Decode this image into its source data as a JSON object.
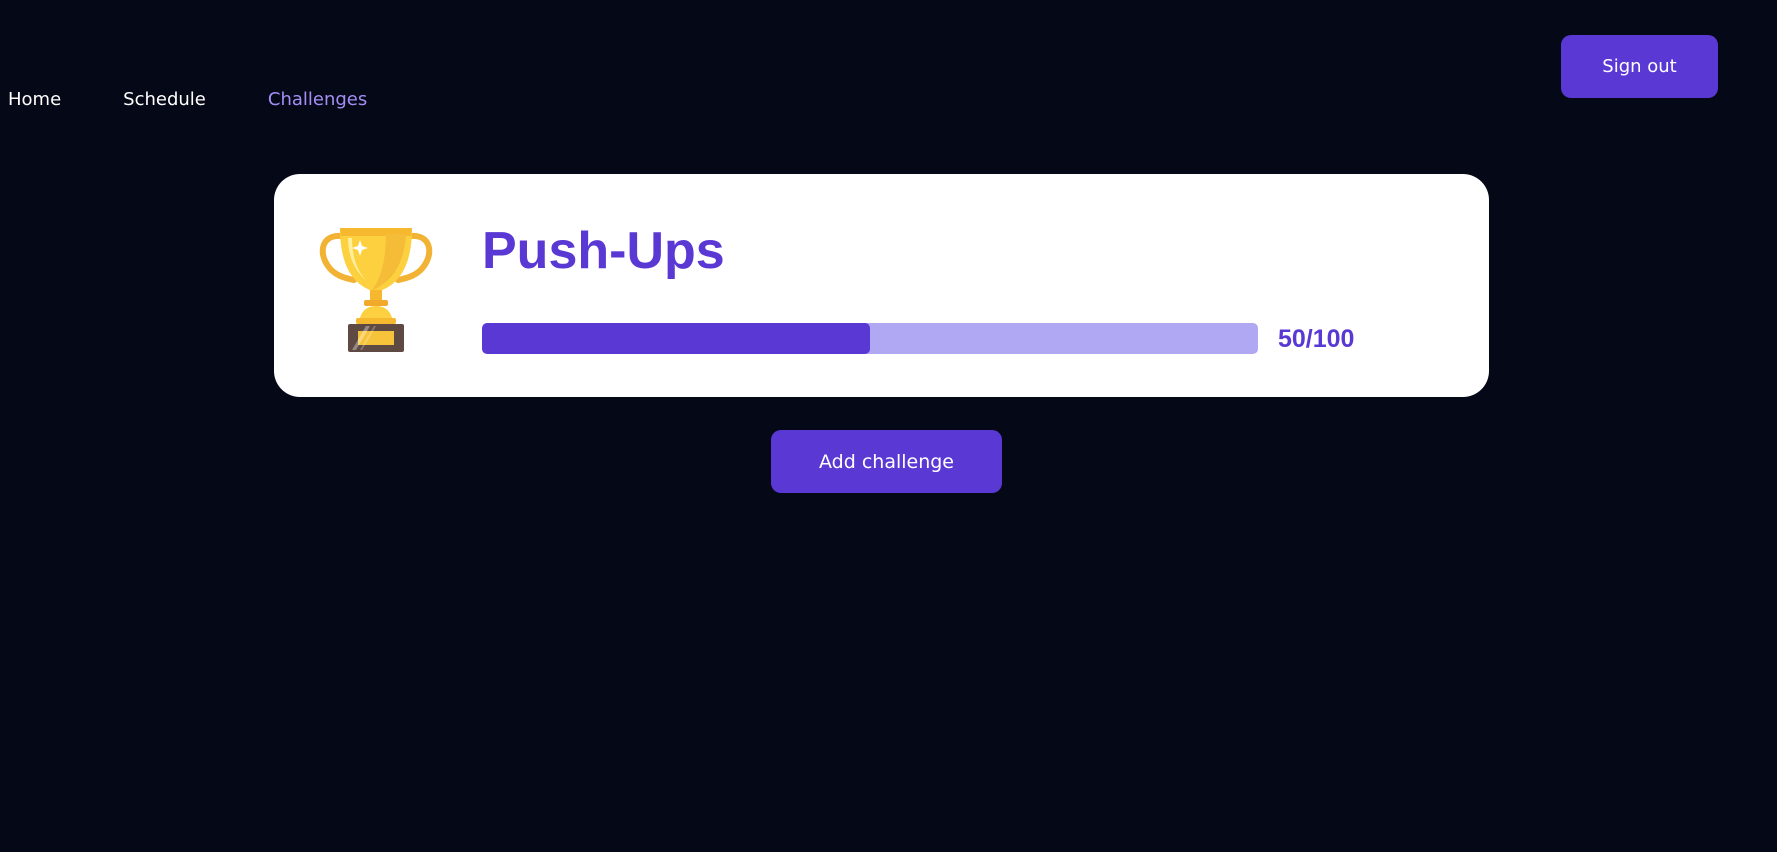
{
  "nav": {
    "items": [
      {
        "label": "Home",
        "active": false
      },
      {
        "label": "Schedule",
        "active": false
      },
      {
        "label": "Challenges",
        "active": true
      }
    ]
  },
  "header": {
    "signout_label": "Sign out"
  },
  "challenge": {
    "title": "Push-Ups",
    "current": 50,
    "target": 100,
    "progress_label": "50/100",
    "icon": "trophy-icon"
  },
  "actions": {
    "add_label": "Add challenge"
  },
  "colors": {
    "background": "#050816",
    "accent": "#5a38d4",
    "accent_light": "#b0a8f2",
    "nav_active": "#a48ef5",
    "nav_text": "#ffffff",
    "card": "#ffffff"
  }
}
